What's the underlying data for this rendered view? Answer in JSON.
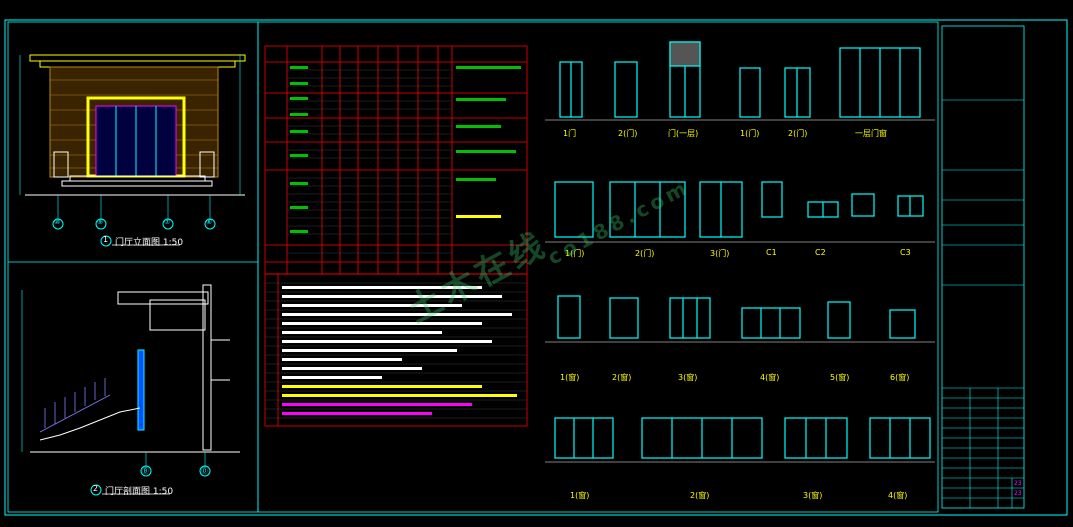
{
  "drawing": {
    "title_elevation": "门厅立面图 1:50",
    "title_section": "门厅剖面图 1:50",
    "elevation_num": "1",
    "section_num": "2",
    "axis_elev": [
      "⑩",
      "⑨",
      "⑦",
      "⑥"
    ],
    "axis_section": [
      "Ⓑ",
      "Ⓓ"
    ],
    "watermark": "土木在线",
    "watermark_sub": "co188.com",
    "doors_row1": [
      "1门",
      "2(门)",
      "门(一层)",
      "1(门)",
      "2(门)",
      "一层门窗"
    ],
    "doors_row2": [
      "1(门)",
      "2(门)",
      "3(门)",
      "C1",
      "C2",
      "C3"
    ],
    "windows_row3": [
      "1(窗)",
      "2(窗)",
      "3(窗)",
      "4(窗)",
      "5(窗)",
      "6(窗)"
    ],
    "windows_row4": [
      "1(窗)",
      "2(窗)",
      "3(窗)",
      "4(窗)"
    ],
    "titleblock_sheet": "23",
    "titleblock_total": "23"
  },
  "colors": {
    "background": "#000000",
    "frame": "#00ffff",
    "table_border": "#ff0000",
    "doors": "#00ffff",
    "facade": "#ffff00",
    "brick": "#b8860b",
    "watermark": "#3cc86e"
  }
}
